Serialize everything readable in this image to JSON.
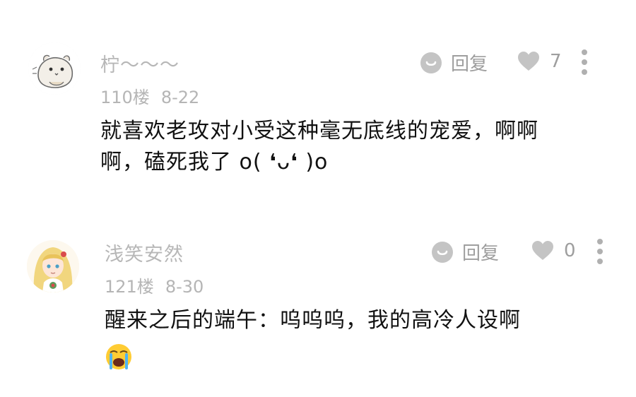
{
  "comments": [
    {
      "username": "柠～～～",
      "floor": "110楼",
      "date": "8-22",
      "reply_label": "回复",
      "like_count": "7",
      "lines": [
        "就喜欢老攻对小受这种毫无底线的宠爱，啊啊",
        "啊，磕死我了 o( ❛ᴗ❛ )o"
      ],
      "avatar_icon": "hamster-avatar"
    },
    {
      "username": "浅笑安然",
      "floor": "121楼",
      "date": "8-30",
      "reply_label": "回复",
      "like_count": "0",
      "lines": [
        "醒来之后的端午：呜呜呜，我的高冷人设啊"
      ],
      "trailing_emoji": "loudly-crying-face-emoji",
      "avatar_icon": "anime-girl-avatar"
    }
  ],
  "colors": {
    "meta_gray": "#b5b5b5",
    "icon_gray": "#b0b0b0",
    "text_black": "#111111"
  }
}
